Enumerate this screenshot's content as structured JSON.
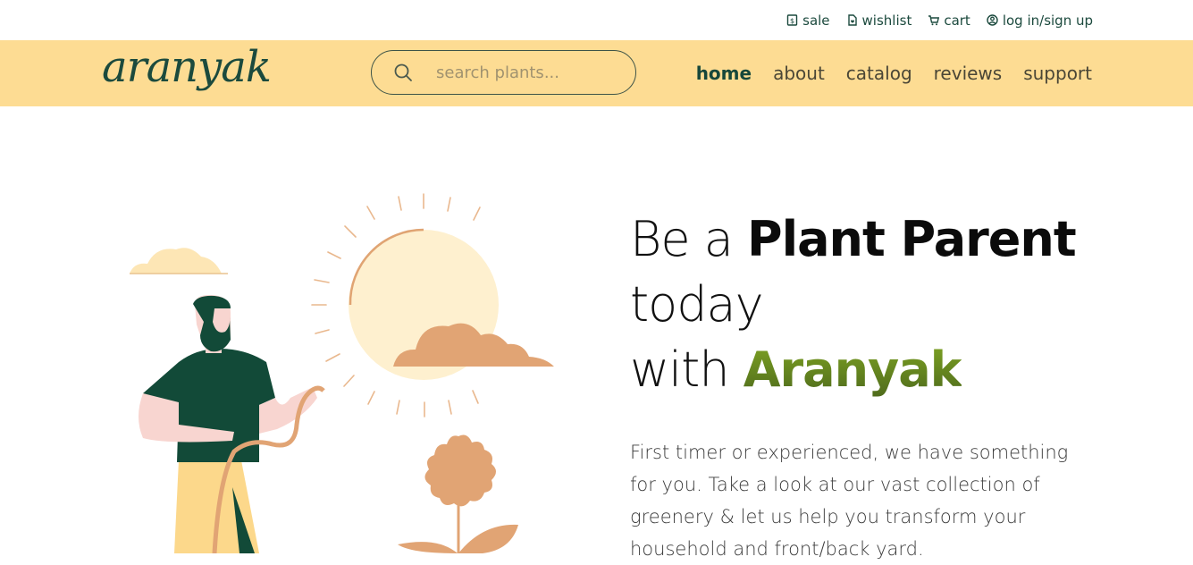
{
  "utility": {
    "links": [
      {
        "label": "sale",
        "icon": "sale-tag-icon"
      },
      {
        "label": "wishlist",
        "icon": "heart-list-icon"
      },
      {
        "label": "cart",
        "icon": "cart-icon"
      },
      {
        "label": "log in/sign up",
        "icon": "user-circle-icon"
      }
    ]
  },
  "navbar": {
    "logo": "aranyak",
    "search": {
      "placeholder": "search plants..."
    },
    "links": [
      {
        "label": "home",
        "active": true
      },
      {
        "label": "about"
      },
      {
        "label": "catalog"
      },
      {
        "label": "reviews"
      },
      {
        "label": "support"
      }
    ]
  },
  "hero": {
    "headline_part1": "Be a ",
    "headline_bold": "Plant Parent",
    "headline_part2": "today",
    "headline_part3": "with ",
    "headline_brand": "Aranyak",
    "paragraph": "First timer or experienced, we have something for you. Take a look at our vast collection of greenery & let us help you transform your household and front/back yard."
  },
  "colors": {
    "navbar_bg": "#fddc93",
    "brand_green": "#1b4a3d",
    "accent_olive": "#6d8a1e",
    "sun": "#fef0cf",
    "cloud": "#e1a474"
  }
}
